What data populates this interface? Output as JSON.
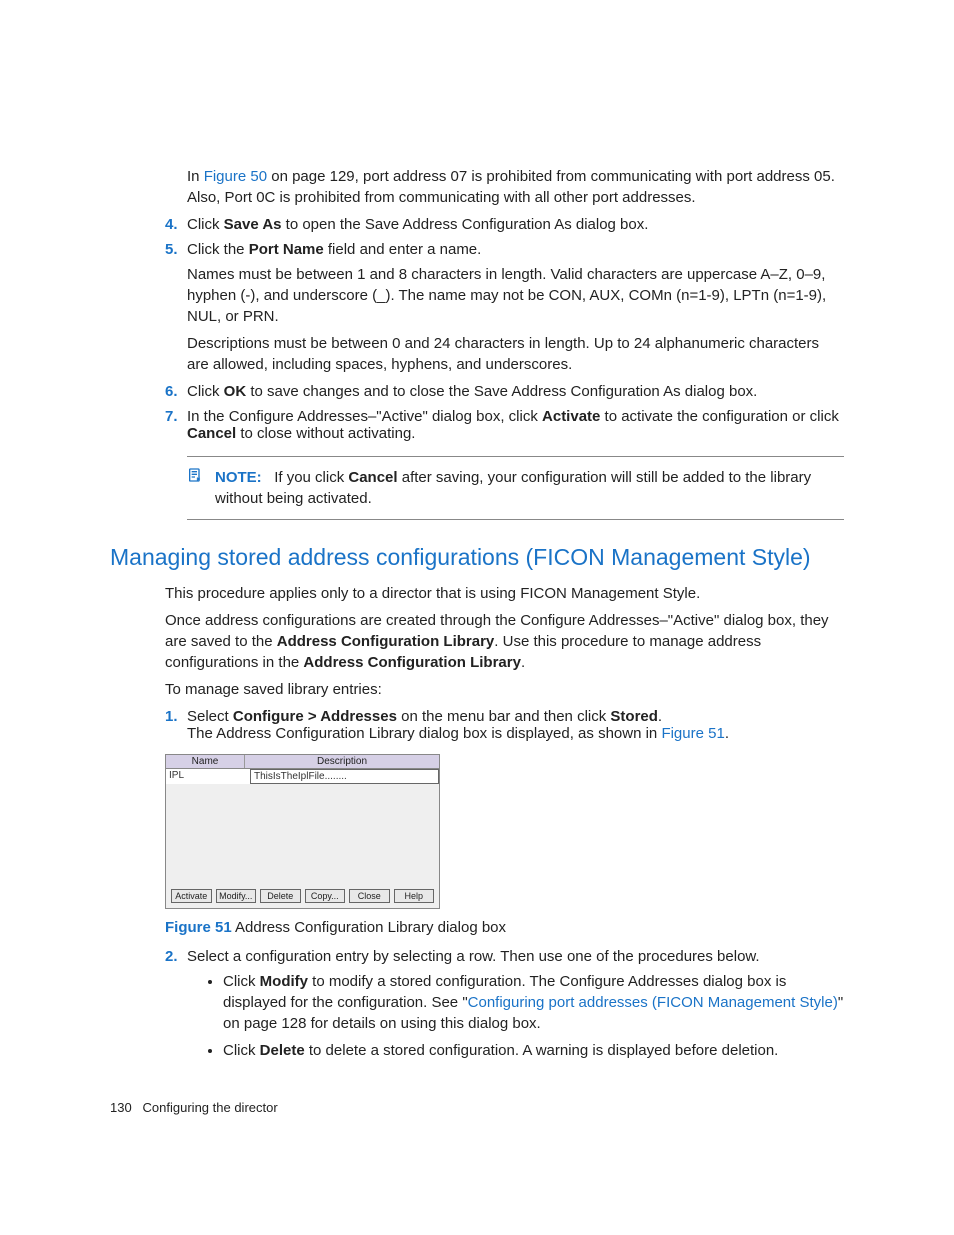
{
  "intro": {
    "text_pre": "In ",
    "figure_ref": "Figure 50",
    "text_post": " on page 129, port address 07 is prohibited from communicating with port address 05. Also, Port 0C is prohibited from communicating with all other port addresses."
  },
  "steps_first": {
    "4": {
      "pre": "Click ",
      "bold": "Save As",
      "post": " to open the Save Address Configuration As dialog box."
    },
    "5": {
      "line1_pre": "Click the ",
      "line1_bold": "Port Name",
      "line1_post": " field and enter a name.",
      "para1": "Names must be between 1 and 8 characters in length. Valid characters are uppercase A–Z, 0–9, hyphen (-), and underscore (_). The name may not be CON, AUX, COMn (n=1-9), LPTn (n=1-9), NUL, or PRN.",
      "para2": "Descriptions must be between 0 and 24 characters in length. Up to 24 alphanumeric characters are allowed, including spaces, hyphens, and underscores."
    },
    "6": {
      "pre": "Click ",
      "bold": "OK",
      "post": " to save changes and to close the Save Address Configuration As dialog box."
    },
    "7": {
      "pre": "In the Configure Addresses–\"Active\" dialog box, click ",
      "bold1": "Activate",
      "mid": " to activate the configuration or click ",
      "bold2": "Cancel",
      "post": " to close without activating."
    }
  },
  "note": {
    "label": "NOTE:",
    "pre": "If you click ",
    "bold": "Cancel",
    "post": " after saving, your configuration will still be added to the library without being activated."
  },
  "heading": "Managing stored address configurations (FICON Management Style)",
  "body": {
    "p1": "This procedure applies only to a director that is using FICON Management Style.",
    "p2_pre": "Once address configurations are created through the Configure Addresses–\"Active\" dialog box, they are saved to the ",
    "p2_b1": "Address Configuration Library",
    "p2_mid": ". Use this procedure to manage address configurations in the ",
    "p2_b2": "Address Configuration Library",
    "p2_post": ".",
    "p3": "To manage saved library entries:"
  },
  "steps_second": {
    "1": {
      "pre": "Select ",
      "bold1": "Configure > Addresses",
      "mid": " on the menu bar and then click ",
      "bold2": "Stored",
      "post": ".",
      "line2_pre": "The Address Configuration Library dialog box is displayed, as shown in ",
      "line2_link": "Figure 51",
      "line2_post": "."
    },
    "2": {
      "text": "Select a configuration entry by selecting a row. Then use one of the procedures below.",
      "bullet1_pre": "Click ",
      "bullet1_bold": "Modify",
      "bullet1_mid": " to modify a stored configuration. The Configure Addresses dialog box is displayed for the configuration. See \"",
      "bullet1_link": "Configuring port addresses (FICON Management Style)",
      "bullet1_post": "\" on page 128 for details on using this dialog box.",
      "bullet2_pre": "Click ",
      "bullet2_bold": "Delete",
      "bullet2_post": " to delete a stored configuration. A warning is displayed before deletion."
    }
  },
  "dialog": {
    "header_name": "Name",
    "header_desc": "Description",
    "row_name": "IPL",
    "row_desc": "ThisIsTheIplFile........",
    "buttons": [
      "Activate",
      "Modify...",
      "Delete",
      "Copy...",
      "Close",
      "Help"
    ]
  },
  "figure": {
    "label": "Figure 51",
    "caption": " Address Configuration Library dialog box"
  },
  "footer": {
    "page": "130",
    "title": "Configuring the director"
  }
}
